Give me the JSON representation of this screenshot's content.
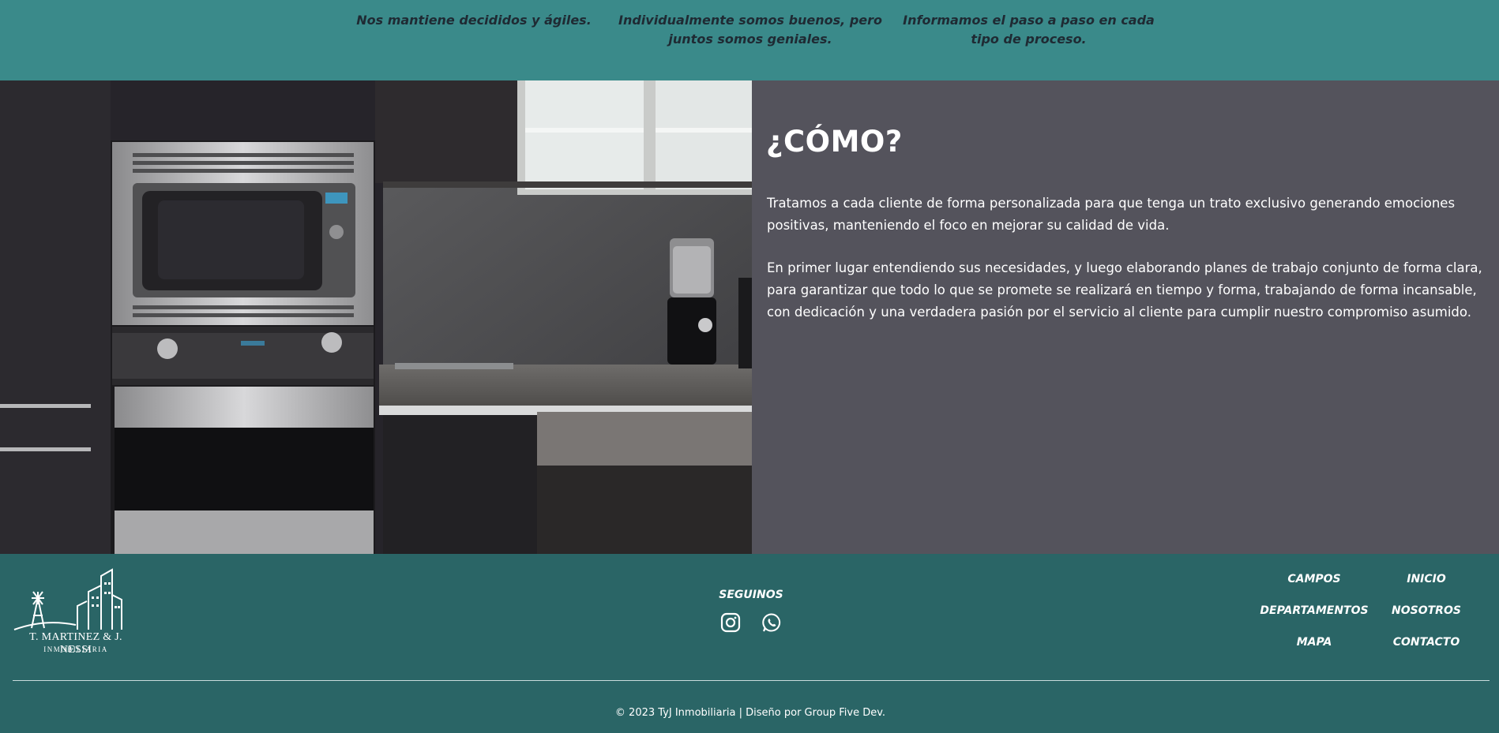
{
  "taglines": [
    "Nos mantiene decididos y ágiles.",
    "Individualmente somos buenos, pero juntos somos geniales.",
    "Informamos el paso a paso en cada tipo de proceso."
  ],
  "hero": {
    "title": "¿CÓMO?",
    "paragraphs": [
      "Tratamos a cada cliente de forma personalizada para que tenga un trato exclusivo generando emociones positivas, manteniendo el foco en mejorar su calidad de vida.",
      "En primer lugar entendiendo sus necesidades, y luego elaborando planes de trabajo conjunto de forma clara, para garantizar que todo lo que se promete se realizará en tiempo y forma, trabajando de forma incansable, con dedicación y una verdadera pasión por el servicio al cliente para cumplir nuestro compromiso asumido."
    ],
    "image_icon": "kitchen-photo"
  },
  "footer": {
    "logo": {
      "name": "T. MARTINEZ & J. NESSI",
      "subtitle": "INMOBILIARIA",
      "icon": "buildings-windmill-logo"
    },
    "social": {
      "label": "SEGUINOS",
      "icons": [
        "instagram-icon",
        "whatsapp-icon"
      ]
    },
    "nav": {
      "campos": "CAMPOS",
      "departamentos": "DEPARTAMENTOS",
      "mapa": "MAPA",
      "inicio": "INICIO",
      "nosotros": "NOSOTROS",
      "contacto": "CONTACTO"
    },
    "copyright": "© 2023 TyJ Inmobiliaria | Diseño por Group Five Dev."
  },
  "colors": {
    "top_band": "#3a8a8a",
    "content_bg": "#54535c",
    "footer_bg": "#2a6566",
    "tagline_text": "#1f2a33",
    "text_light": "#ffffff"
  }
}
